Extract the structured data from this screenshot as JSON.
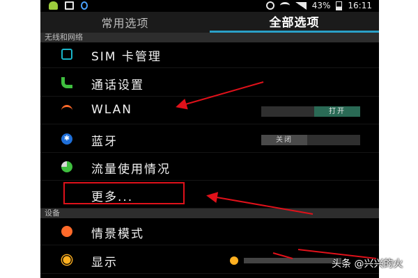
{
  "status_bar": {
    "battery_percent": "43%",
    "time": "16:11"
  },
  "tabs": [
    {
      "label": "常用选项",
      "active": false
    },
    {
      "label": "全部选项",
      "active": true
    }
  ],
  "sections": {
    "wireless": {
      "header": "无线和网络"
    },
    "device": {
      "header": "设备"
    }
  },
  "items": {
    "sim": {
      "label": "SIM 卡管理",
      "icon": "sim-card-icon"
    },
    "call": {
      "label": "通话设置",
      "icon": "phone-icon"
    },
    "wlan": {
      "label": "WLAN",
      "icon": "wifi-icon",
      "toggle": "打开"
    },
    "bluetooth": {
      "label": "蓝牙",
      "icon": "bluetooth-icon",
      "toggle": "关闭"
    },
    "data_usage": {
      "label": "流量使用情况",
      "icon": "data-usage-icon"
    },
    "more": {
      "label": "更多..."
    },
    "scene": {
      "label": "情景模式",
      "icon": "scene-mode-icon"
    },
    "display": {
      "label": "显示",
      "icon": "brightness-icon"
    }
  },
  "colors": {
    "accent": "#2aa0c8",
    "annotation_red": "#e0111a",
    "toggle_on": "#2a6a55"
  },
  "watermark": "头条 @兴兴的火"
}
